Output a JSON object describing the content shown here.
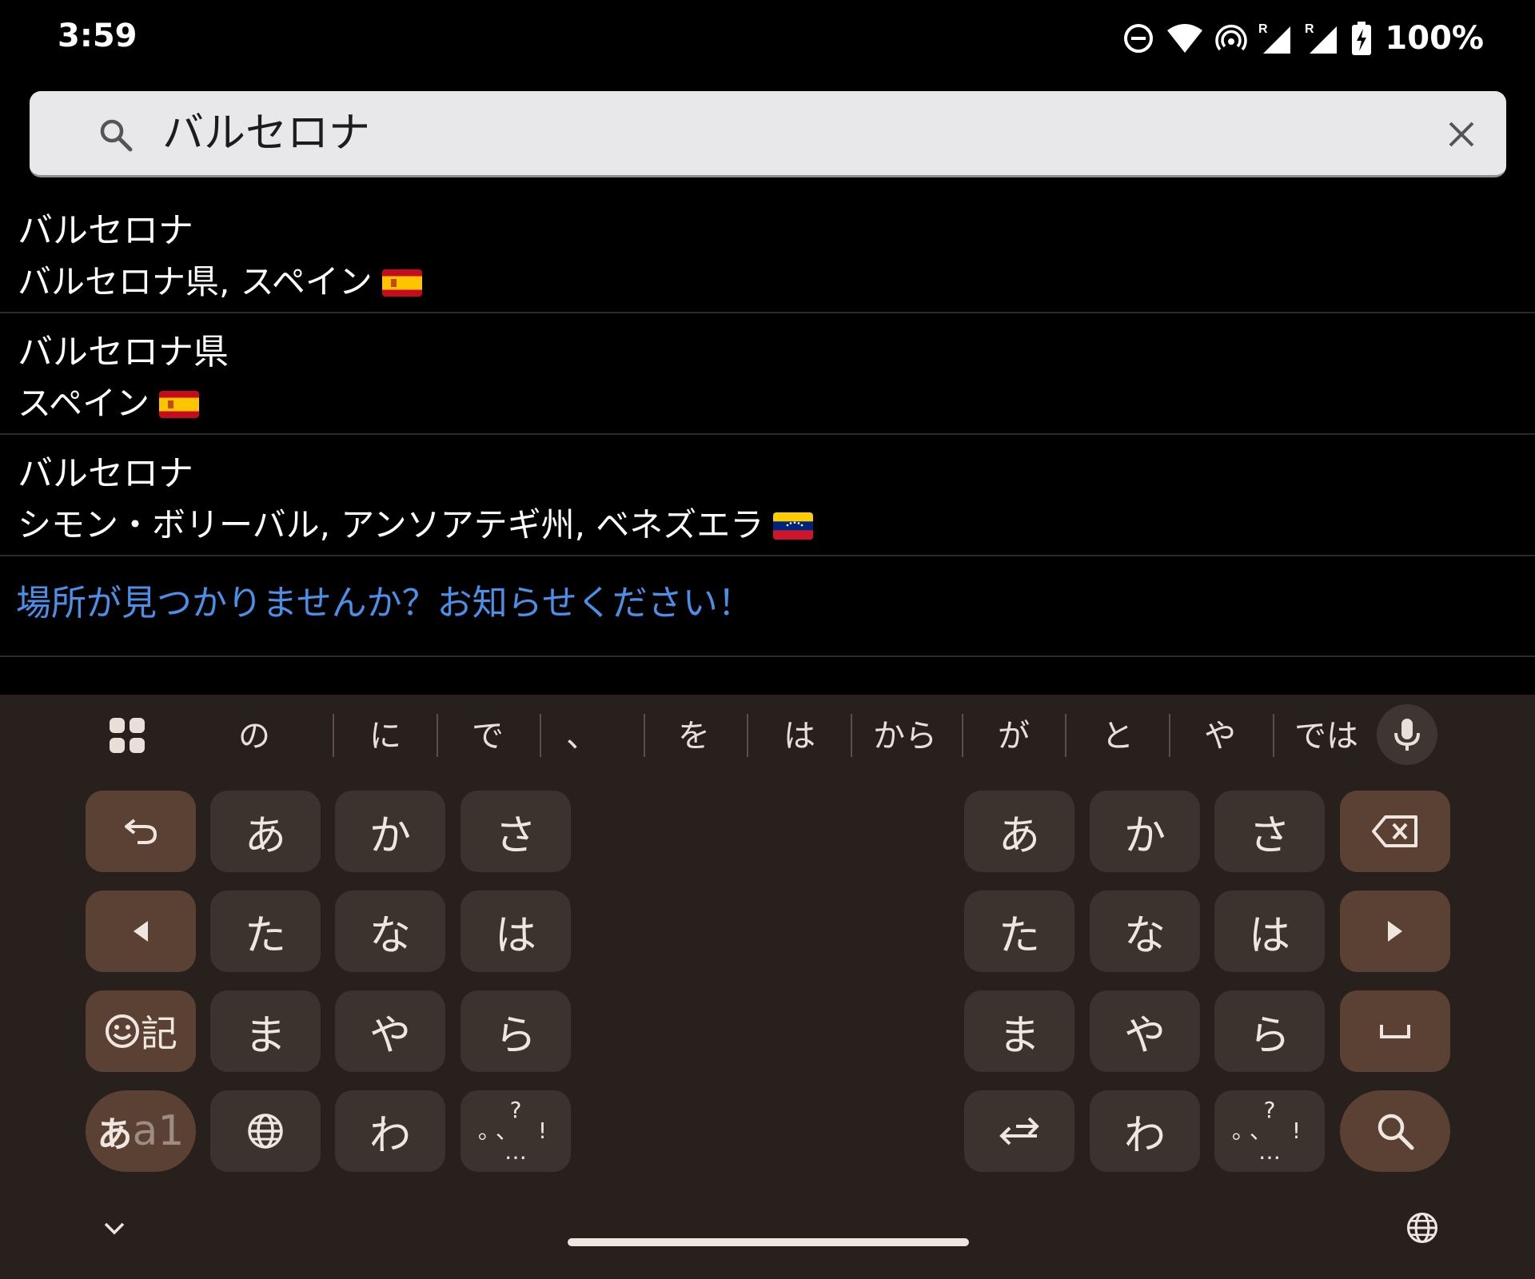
{
  "status_bar": {
    "time": "3:59",
    "battery": "100%",
    "icons": [
      "do-not-disturb-icon",
      "wifi-icon",
      "hotspot-icon",
      "signal-roaming-icon",
      "signal-roaming-icon",
      "battery-charging-icon"
    ]
  },
  "search": {
    "query": "バルセロナ",
    "icon": "search-icon",
    "clear_icon": "close-icon"
  },
  "results": [
    {
      "title": "バルセロナ",
      "subtitle": "バルセロナ県, スペイン",
      "flag": "spain-flag-icon"
    },
    {
      "title": "バルセロナ県",
      "subtitle": "スペイン",
      "flag": "spain-flag-icon"
    },
    {
      "title": "バルセロナ",
      "subtitle": "シモン・ボリーバル, アンソアテギ州, ベネズエラ",
      "flag": "venezuela-flag-icon"
    }
  ],
  "feedback_link": "場所が見つかりませんか？お知らせください！",
  "keyboard": {
    "suggestions": [
      "の",
      "に",
      "で",
      "、",
      "を",
      "は",
      "から",
      "が",
      "と",
      "や",
      "では"
    ],
    "left_pad": {
      "row1": [
        "あ",
        "か",
        "さ"
      ],
      "row2": [
        "た",
        "な",
        "は"
      ],
      "row3": [
        "ま",
        "や",
        "ら"
      ],
      "row4": [
        "わ"
      ],
      "emoji_key": "記",
      "mode_key_a": "あ",
      "mode_key_b": "a1"
    },
    "right_pad": {
      "row1": [
        "あ",
        "か",
        "さ"
      ],
      "row2": [
        "た",
        "な",
        "は"
      ],
      "row3": [
        "ま",
        "や",
        "ら"
      ],
      "row4": [
        "わ"
      ]
    },
    "punct_key": {
      "top": "?",
      "middle": "。、 !",
      "bottom": "…"
    },
    "colors": {
      "background": "#28201c",
      "key": "#3d332e",
      "function_key": "#5b4134",
      "link": "#4a8fe8"
    }
  }
}
